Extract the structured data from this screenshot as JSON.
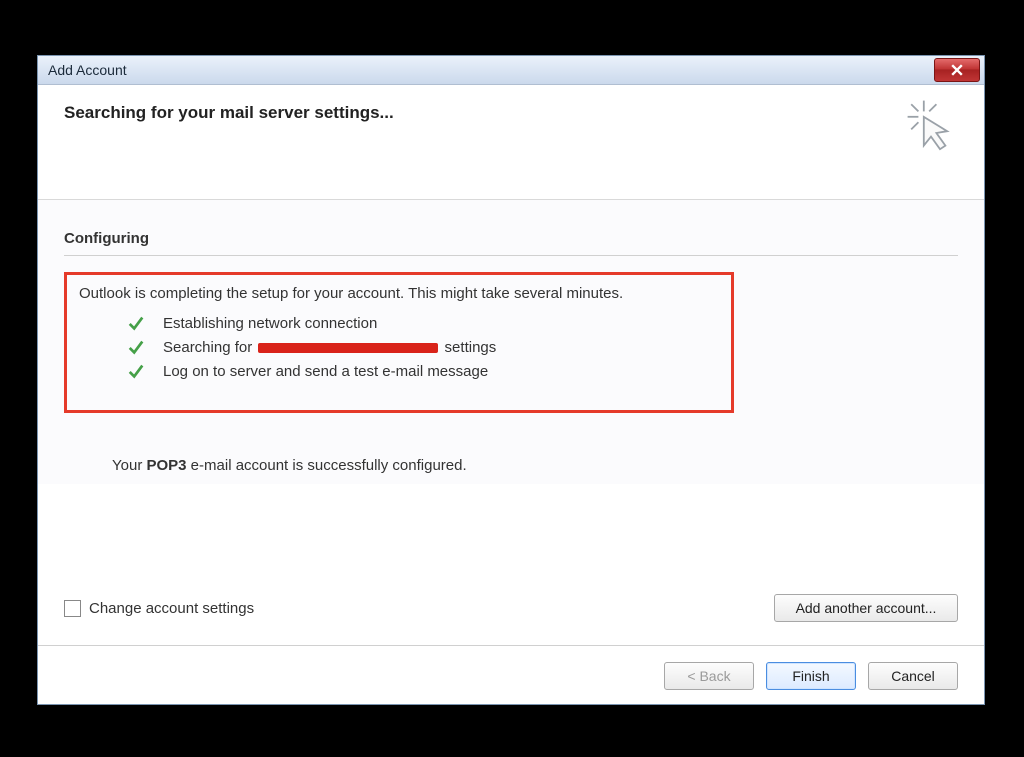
{
  "window": {
    "title": "Add Account"
  },
  "header": {
    "heading": "Searching for your mail server settings..."
  },
  "config": {
    "section_label": "Configuring",
    "intro": "Outlook is completing the setup for your account. This might take several minutes.",
    "steps": {
      "s1": "Establishing network connection",
      "s2_prefix": "Searching for ",
      "s2_suffix": " settings",
      "s3": "Log on to server and send a test e-mail message"
    },
    "success_prefix": "Your ",
    "success_bold": "POP3",
    "success_suffix": " e-mail account is successfully configured."
  },
  "options": {
    "change_settings_label": "Change account settings",
    "add_another_label": "Add another account..."
  },
  "footer": {
    "back": "< Back",
    "finish": "Finish",
    "cancel": "Cancel"
  }
}
